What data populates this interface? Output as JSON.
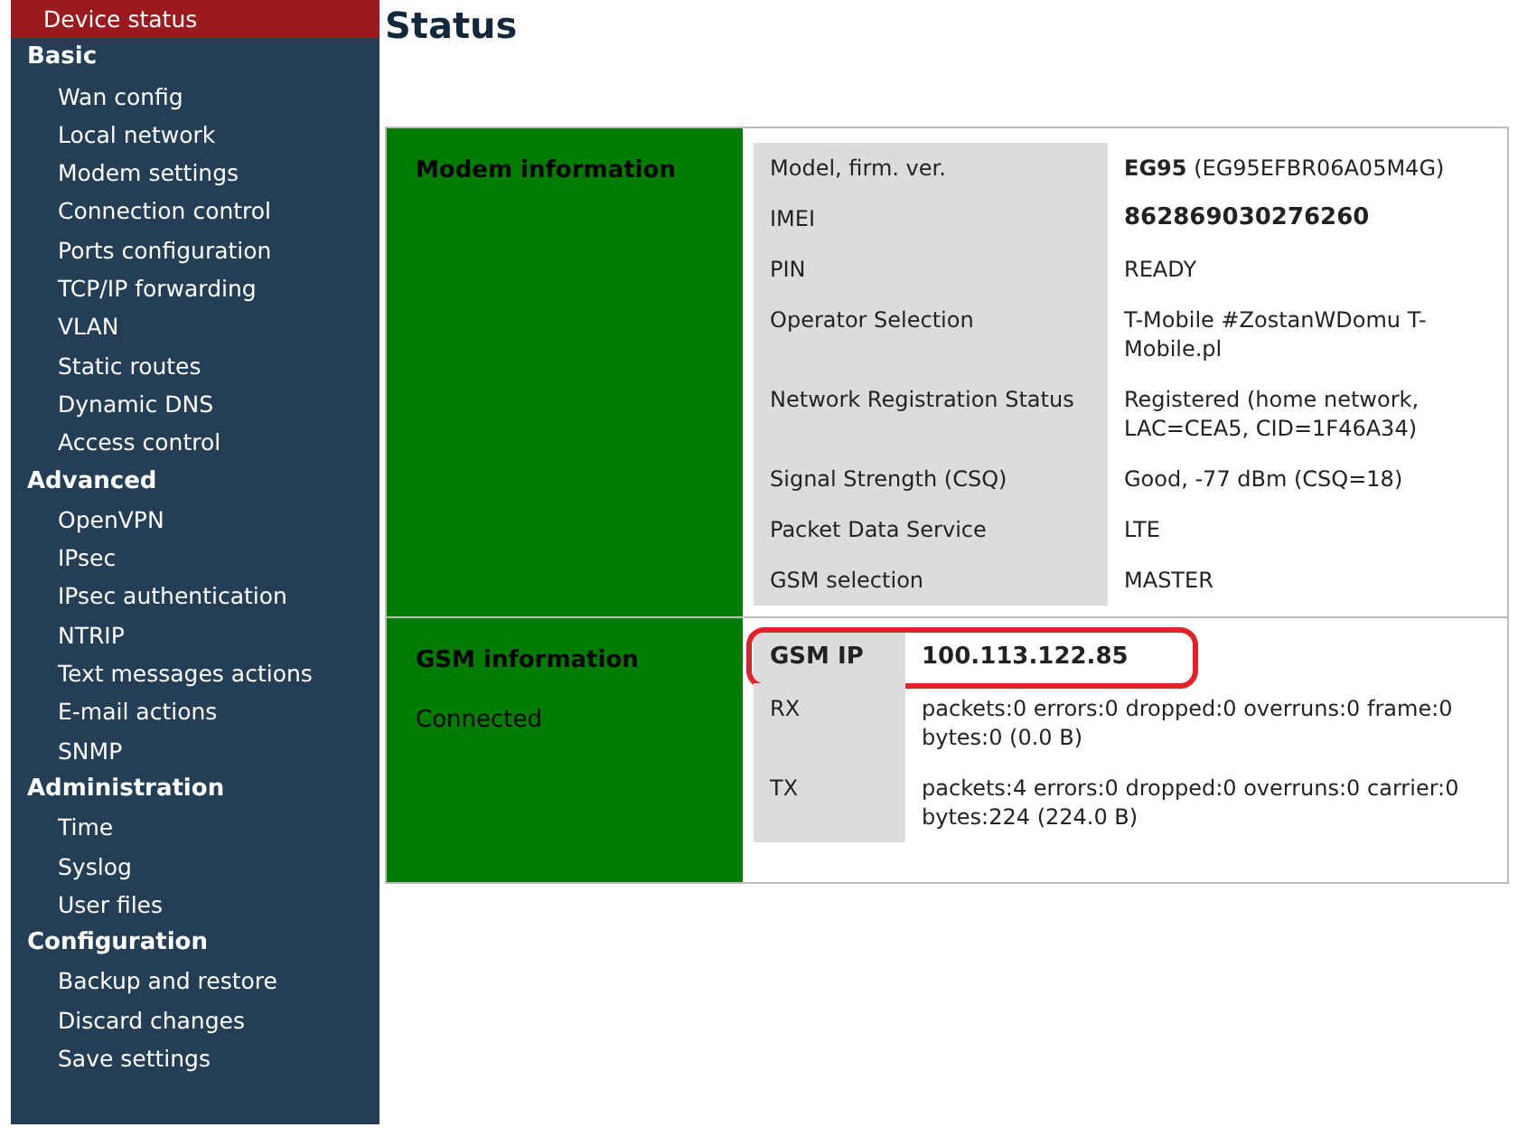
{
  "sidebar": {
    "items": [
      {
        "kind": "item",
        "label": "Device status",
        "selected": true
      },
      {
        "kind": "header",
        "label": "Basic"
      },
      {
        "kind": "item",
        "label": "Wan config",
        "selected": false
      },
      {
        "kind": "item",
        "label": "Local network",
        "selected": false
      },
      {
        "kind": "item",
        "label": "Modem settings",
        "selected": false
      },
      {
        "kind": "item",
        "label": "Connection control",
        "selected": false
      },
      {
        "kind": "item",
        "label": "Ports configuration",
        "selected": false
      },
      {
        "kind": "item",
        "label": "TCP/IP forwarding",
        "selected": false
      },
      {
        "kind": "item",
        "label": "VLAN",
        "selected": false
      },
      {
        "kind": "item",
        "label": "Static routes",
        "selected": false
      },
      {
        "kind": "item",
        "label": "Dynamic DNS",
        "selected": false
      },
      {
        "kind": "item",
        "label": "Access control",
        "selected": false
      },
      {
        "kind": "header",
        "label": "Advanced"
      },
      {
        "kind": "item",
        "label": "OpenVPN",
        "selected": false
      },
      {
        "kind": "item",
        "label": "IPsec",
        "selected": false
      },
      {
        "kind": "item",
        "label": "IPsec authentication",
        "selected": false
      },
      {
        "kind": "item",
        "label": "NTRIP",
        "selected": false
      },
      {
        "kind": "item",
        "label": "Text messages actions",
        "selected": false
      },
      {
        "kind": "item",
        "label": "E-mail actions",
        "selected": false
      },
      {
        "kind": "item",
        "label": "SNMP",
        "selected": false
      },
      {
        "kind": "header",
        "label": "Administration"
      },
      {
        "kind": "item",
        "label": "Time",
        "selected": false
      },
      {
        "kind": "item",
        "label": "Syslog",
        "selected": false
      },
      {
        "kind": "item",
        "label": "User files",
        "selected": false
      },
      {
        "kind": "header",
        "label": "Configuration"
      },
      {
        "kind": "item",
        "label": "Backup and restore",
        "selected": false
      },
      {
        "kind": "item",
        "label": "Discard changes",
        "selected": false
      },
      {
        "kind": "item",
        "label": "Save settings",
        "selected": false
      }
    ]
  },
  "page_title": "Status",
  "sections": [
    {
      "title": "Modem information",
      "rows": [
        {
          "label": "Model, firm. ver.",
          "value": "**EG95** (EG95EFBR06A05M4G)",
          "bold": false,
          "highlighted": false
        },
        {
          "label": "IMEI",
          "value": "862869030276260",
          "bold": true,
          "highlighted": false
        },
        {
          "label": "PIN",
          "value": "READY",
          "bold": false,
          "highlighted": false
        },
        {
          "label": "Operator Selection",
          "value": "T-Mobile #ZostanWDomu T-Mobile.pl",
          "bold": false,
          "highlighted": false
        },
        {
          "label": "Network Registration Status",
          "value": "Registered (home network, LAC=CEA5, CID=1F46A34)",
          "bold": false,
          "highlighted": false
        },
        {
          "label": "Signal Strength (CSQ)",
          "value": "Good, -77 dBm (CSQ=18)",
          "bold": false,
          "highlighted": false
        },
        {
          "label": "Packet Data Service",
          "value": "LTE",
          "bold": false,
          "highlighted": false
        },
        {
          "label": "GSM selection",
          "value": "MASTER",
          "bold": false,
          "highlighted": false
        }
      ]
    },
    {
      "title": "GSM information",
      "status": "Connected",
      "rows": [
        {
          "label": "GSM IP",
          "value": "100.113.122.85",
          "bold": true,
          "highlighted": true
        },
        {
          "label": "RX",
          "value": "packets:0 errors:0 dropped:0 overruns:0 frame:0 bytes:0 (0.0 B)",
          "bold": false,
          "highlighted": false
        },
        {
          "label": "TX",
          "value": "packets:4 errors:0 dropped:0 overruns:0 carrier:0 bytes:224 (224.0 B)",
          "bold": false,
          "highlighted": false
        }
      ]
    }
  ]
}
